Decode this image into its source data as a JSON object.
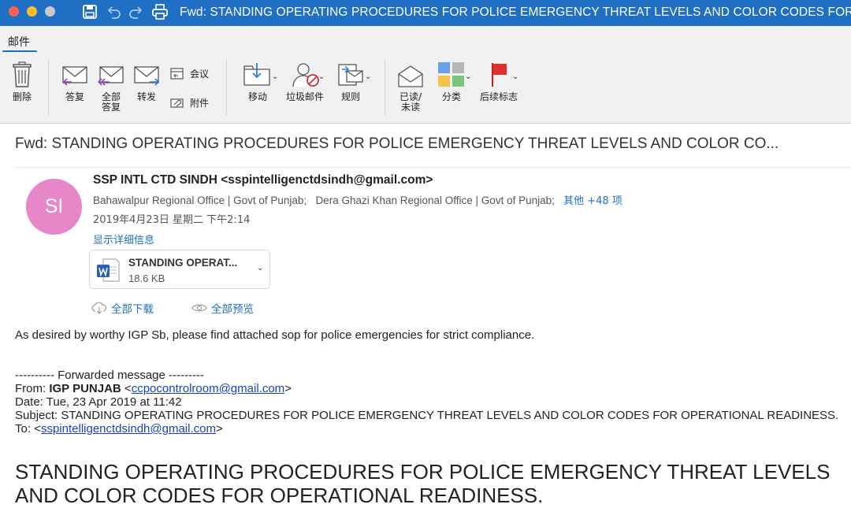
{
  "window": {
    "title": "Fwd: STANDING OPERATING PROCEDURES FOR POLICE EMERGENCY THREAT LEVELS AND COLOR CODES FOR...",
    "accent_color": "#1f6fc5"
  },
  "ribbon": {
    "tab_mail": "邮件"
  },
  "toolbar": {
    "delete_label": "删除",
    "reply_label": "答复",
    "reply_all_label_line1": "全部",
    "reply_all_label_line2": "答复",
    "forward_label": "转发",
    "meeting_label": "会议",
    "attachment_label": "附件",
    "move_label": "移动",
    "junk_label": "垃圾邮件",
    "rules_label": "规则",
    "read_unread_line1": "已读/",
    "read_unread_line2": "未读",
    "categorize_label": "分类",
    "followup_label": "后续标志"
  },
  "message": {
    "subject": "Fwd: STANDING OPERATING PROCEDURES FOR POLICE EMERGENCY THREAT LEVELS AND COLOR CO...",
    "avatar_initials": "SI",
    "avatar_color": "#e887c8",
    "sender": "SSP INTL CTD SINDH <sspintelligenctdsindh@gmail.com>",
    "recipient_1": "Bahawalpur Regional Office | Govt of Punjab;",
    "recipient_2": "Dera Ghazi Khan Regional Office | Govt of Punjab;",
    "recipients_more": "其他 +48 项",
    "date": "2019年4月23日 星期二 下午2:14",
    "show_details": "显示详细信息",
    "attachment": {
      "name": "STANDING OPERAT...",
      "size": "18.6 KB"
    },
    "download_all": "全部下载",
    "preview_all": "全部预览",
    "body_line": "As desired by worthy IGP Sb, please find attached sop for police emergencies for strict compliance.",
    "forwarded": {
      "header": "---------- Forwarded message ---------",
      "from_prefix": "From: ",
      "from_name": "IGP PUNJAB",
      "from_email": "ccpocontrolroom@gmail.com",
      "date_line": "Date: Tue, 23 Apr 2019 at 11:42",
      "subject_line": "Subject: STANDING OPERATING PROCEDURES FOR POLICE EMERGENCY THREAT LEVELS AND COLOR CODES FOR OPERATIONAL READINESS.",
      "to_prefix": "To: ",
      "to_email": "sspintelligenctdsindh@gmail.com"
    },
    "heading": "STANDING OPERATING PROCEDURES FOR POLICE EMERGENCY THREAT LEVELS AND COLOR CODES FOR OPERATIONAL READINESS."
  }
}
